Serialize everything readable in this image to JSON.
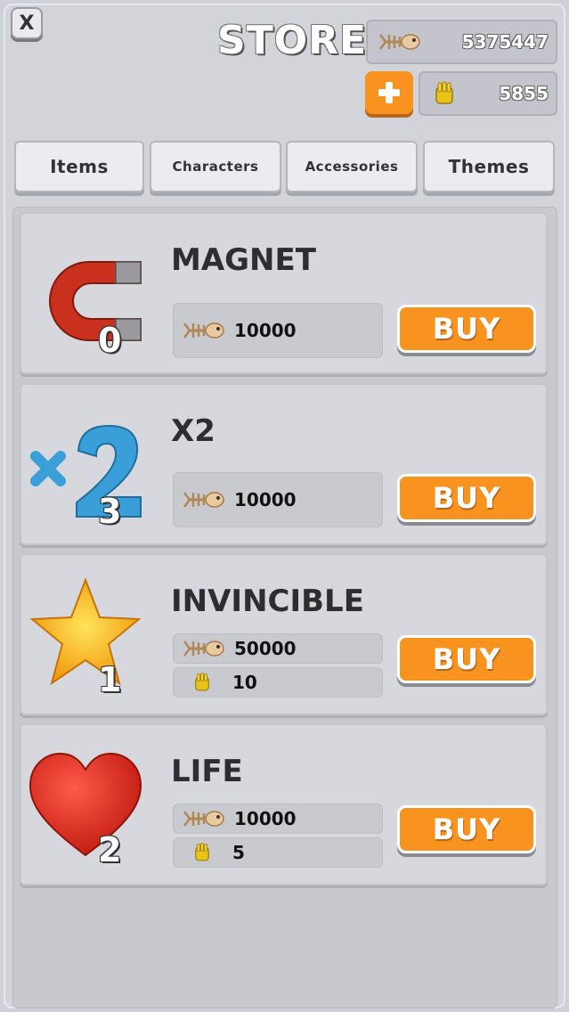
{
  "header": {
    "title": "STORE",
    "close_label": "X",
    "fish_balance": "5375447",
    "gold_balance": "5855"
  },
  "tabs": [
    {
      "label": "Items"
    },
    {
      "label": "Characters"
    },
    {
      "label": "Accessories"
    },
    {
      "label": "Themes"
    }
  ],
  "items": [
    {
      "name": "MAGNET",
      "count": "0",
      "fish_price": "10000",
      "buy_label": "BUY"
    },
    {
      "name": "X2",
      "count": "3",
      "fish_price": "10000",
      "buy_label": "BUY"
    },
    {
      "name": "INVINCIBLE",
      "count": "1",
      "fish_price": "50000",
      "gold_price": "10",
      "buy_label": "BUY"
    },
    {
      "name": "LIFE",
      "count": "2",
      "fish_price": "10000",
      "gold_price": "5",
      "buy_label": "BUY"
    }
  ],
  "colors": {
    "accent": "#f7931e",
    "panel": "#d7d8dd"
  },
  "icons": [
    "close-icon",
    "fish-bone-icon",
    "gold-icon",
    "plus-icon",
    "magnet-icon",
    "x2-icon",
    "star-icon",
    "heart-icon"
  ]
}
